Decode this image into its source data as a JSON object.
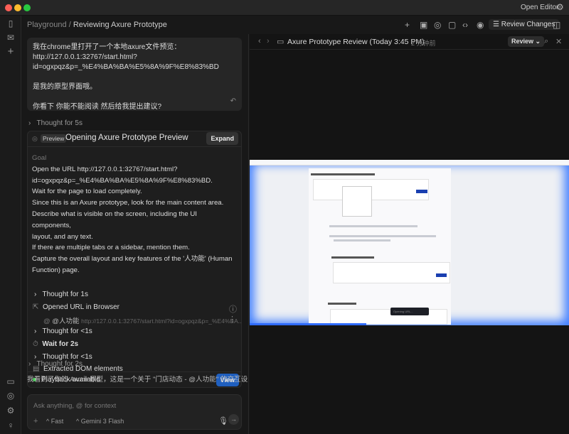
{
  "titlebar": {
    "open_editor": "Open Editor"
  },
  "breadcrumb": {
    "parent": "Playground",
    "separator": "/",
    "current": "Reviewing Axure Prototype"
  },
  "toolbar": {
    "review_changes": "Review Changes"
  },
  "user_message": {
    "line1": "我在chrome里打开了一个本地axure文件预览：",
    "line2": "http://127.0.0.1:32767/start.html?",
    "line3": "id=ogxpqz&p=_%E4%BA%BA%E5%8A%9F%E8%83%BD",
    "line4": "是我的原型界面哦。",
    "line5": "你看下 你能不能阅读 然后给我提出建议?"
  },
  "thought1": "Thought for 5s",
  "task": {
    "badge": "Preview",
    "title": "Opening Axure Prototype Preview",
    "expand": "Expand",
    "goal_label": "Goal",
    "goal_lines": [
      "Open the URL http://127.0.0.1:32767/start.html?",
      "id=ogxpqz&p=_%E4%BA%BA%E5%8A%9F%E8%83%BD.",
      "Wait for the page to load completely.",
      "Since this is an Axure prototype, look for the main content area.",
      "Describe what is visible on the screen, including the UI components,",
      "layout, and any text.",
      "If there are multiple tabs or a sidebar, mention them.",
      "Capture the overall layout and key features of the '人功能' (Human",
      "Function) page."
    ],
    "steps": {
      "t1": "Thought for 1s",
      "opened": "Opened URL in Browser",
      "page_name": "@人功能",
      "url": "http://127.0.0.1:32767/start.html?id=ogxpqz&p=_%E4%BA...",
      "t2": "Thought for <1s",
      "wait": "Wait for 2s",
      "t3": "Thought for <1s",
      "extracted": "Extracted DOM elements"
    },
    "playback": "Playback available",
    "view": "View"
  },
  "thought2": "Thought for 2s",
  "reply": "我看到了你的 Axure 原型，这是一个关于 \"门店动态 - @人功能\" 的交互设",
  "composer": {
    "placeholder": "Ask anything, @ for context",
    "mode": "Fast",
    "model": "Gemini 3 Flash"
  },
  "preview": {
    "title": "Axure Prototype Review (Today 3:45 PM)",
    "time_ago": "2 分钟前",
    "review": "Review",
    "loading": "Opening URL..."
  },
  "colors": {
    "accent": "#1f5fbf",
    "glow": "#3d7cff",
    "playback": "#3ccf4e"
  }
}
